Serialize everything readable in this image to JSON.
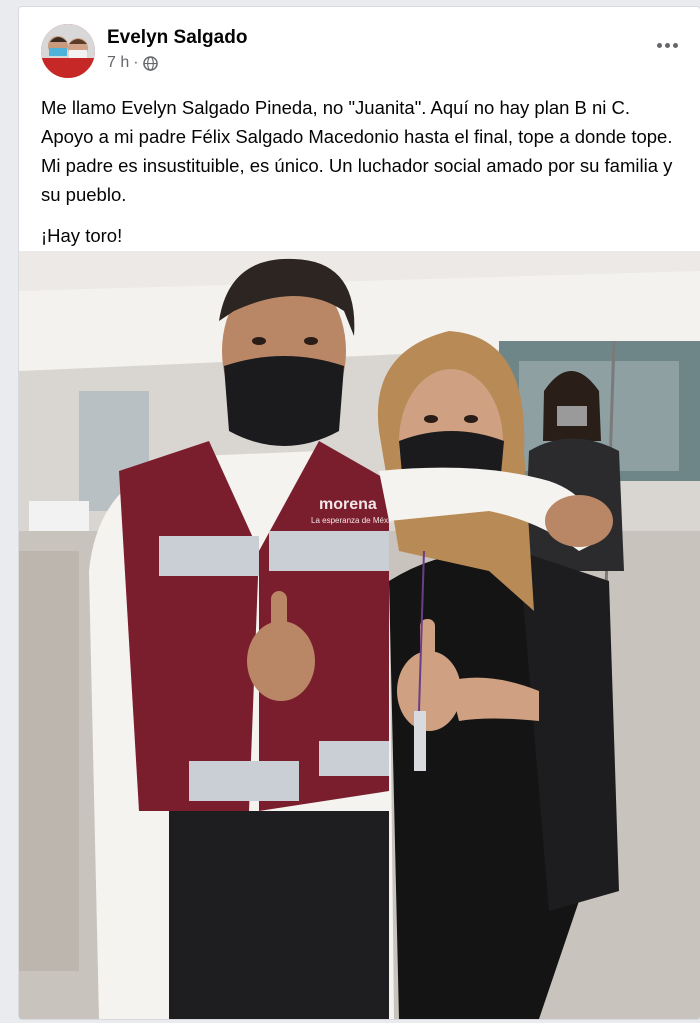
{
  "post": {
    "author": "Evelyn Salgado",
    "timestamp": "7 h",
    "separator": "·",
    "privacy_icon": "globe-icon",
    "more_icon": "more-options-icon",
    "paragraph_1": "Me llamo Evelyn Salgado Pineda, no \"Juanita\". Aquí no hay plan B ni C. Apoyo a mi padre Félix Salgado Macedonio hasta el final, tope a donde tope. Mi padre es insustituible, es único. Un luchador social amado por su familia y su pueblo.",
    "paragraph_2": "¡Hay toro!"
  },
  "photo": {
    "vest_logo_text": "morena",
    "vest_sub_text": "La esperanza de México"
  },
  "colors": {
    "vest": "#7a1e2e",
    "reflective": "#c9cfd4",
    "mask": "#1b1b1d",
    "text": "#050505",
    "secondary_text": "#65676b"
  }
}
